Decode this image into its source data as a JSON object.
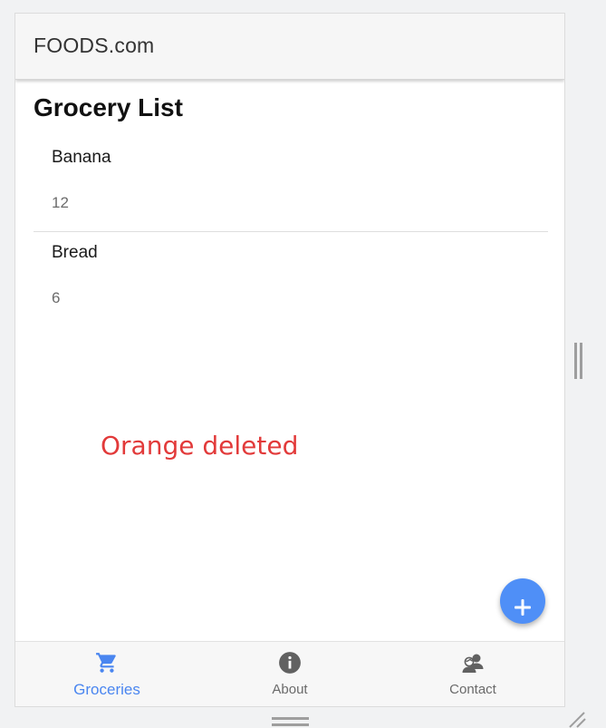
{
  "app_bar": {
    "title": "FOODS.com"
  },
  "page": {
    "title": "Grocery List"
  },
  "groceries": [
    {
      "name": "Banana",
      "quantity": "12"
    },
    {
      "name": "Bread",
      "quantity": "6"
    }
  ],
  "toast": {
    "message": "Orange deleted",
    "color": "#e23a3a"
  },
  "fab": {
    "icon": "plus-icon",
    "color": "#4f8ff7"
  },
  "bottom_nav": {
    "items": [
      {
        "label": "Groceries",
        "icon": "shopping-cart-icon",
        "active": true
      },
      {
        "label": "About",
        "icon": "info-icon",
        "active": false
      },
      {
        "label": "Contact",
        "icon": "contacts-icon",
        "active": false
      }
    ]
  },
  "colors": {
    "accent": "#4a86f0",
    "inactive_icon": "#616161"
  }
}
